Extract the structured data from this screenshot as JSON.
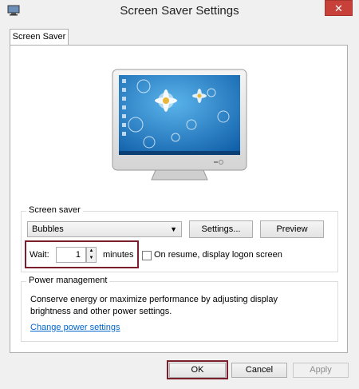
{
  "window": {
    "title": "Screen Saver Settings",
    "close_glyph": "✕"
  },
  "tabs": [
    {
      "label": "Screen Saver"
    }
  ],
  "screen_saver": {
    "group_label": "Screen saver",
    "selected": "Bubbles",
    "settings_label": "Settings...",
    "preview_label": "Preview",
    "wait_label": "Wait:",
    "wait_value": "1",
    "minutes_label": "minutes",
    "resume_label": "On resume, display logon screen",
    "resume_checked": false
  },
  "power": {
    "group_label": "Power management",
    "description": "Conserve energy or maximize performance by adjusting display brightness and other power settings.",
    "link_label": "Change power settings"
  },
  "footer": {
    "ok_label": "OK",
    "cancel_label": "Cancel",
    "apply_label": "Apply"
  },
  "colors": {
    "close_bg": "#c7413a",
    "highlight": "#7a1f2b",
    "link": "#0066cc",
    "desktop": "#1f79c6"
  },
  "icons": [
    "screen-saver-app-icon",
    "close-icon",
    "dropdown-arrow-icon",
    "spin-up-icon",
    "spin-down-icon"
  ]
}
